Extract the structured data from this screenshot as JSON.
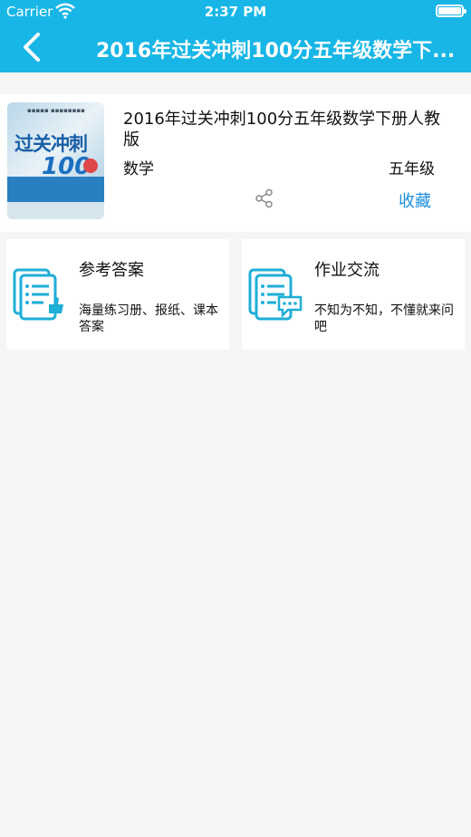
{
  "status_bar": {
    "carrier": "Carrier",
    "time": "2:37 PM"
  },
  "nav": {
    "title": "2016年过关冲刺100分五年级数学下..."
  },
  "book": {
    "title": "2016年过关冲刺100分五年级数学下册人教版",
    "subject": "数学",
    "grade": "五年级",
    "favorite_label": "收藏",
    "cover": {
      "title": "过关冲刺",
      "number": "100"
    }
  },
  "tiles": [
    {
      "title": "参考答案",
      "description": "海量练习册、报纸、课本答案",
      "icon": "document-thumbs-up-icon"
    },
    {
      "title": "作业交流",
      "description": "不知为不知，不懂就来问吧",
      "icon": "document-chat-icon"
    }
  ],
  "colors": {
    "accent": "#17b6e6",
    "link": "#1a8ee0",
    "background": "#f4f5f4"
  }
}
